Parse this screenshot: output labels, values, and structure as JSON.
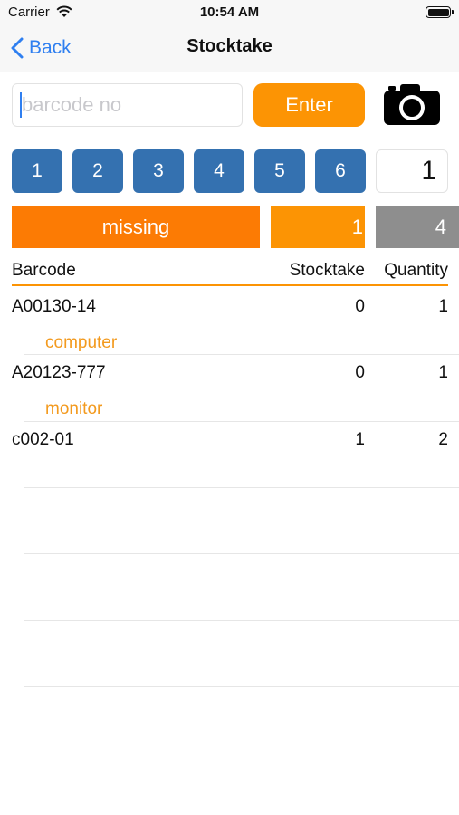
{
  "status_bar": {
    "carrier": "Carrier",
    "time": "10:54 AM"
  },
  "nav": {
    "back_label": "Back",
    "title": "Stocktake"
  },
  "search": {
    "placeholder": "barcode no",
    "enter_label": "Enter"
  },
  "number_buttons": [
    "1",
    "2",
    "3",
    "4",
    "5",
    "6"
  ],
  "selected_number": "1",
  "summary": {
    "status_label": "missing",
    "count_orange": "1",
    "count_gray": "4"
  },
  "table": {
    "headers": {
      "barcode": "Barcode",
      "stocktake": "Stocktake",
      "quantity": "Quantity"
    },
    "rows": [
      {
        "barcode": "A00130-14",
        "stocktake": "0",
        "quantity": "1",
        "description": "computer"
      },
      {
        "barcode": "A20123-777",
        "stocktake": "0",
        "quantity": "1",
        "description": "monitor"
      },
      {
        "barcode": "c002-01",
        "stocktake": "1",
        "quantity": "2",
        "description": ""
      }
    ]
  },
  "colors": {
    "accent": "#fc9404",
    "button_blue": "#3471b0",
    "missing_orange": "#fc7b04",
    "gray": "#8e8e8e",
    "link_blue": "#2f7ff0"
  },
  "icons": {
    "camera": "camera-icon",
    "back": "chevron-left-icon",
    "wifi": "wifi-icon",
    "battery": "battery-icon"
  }
}
